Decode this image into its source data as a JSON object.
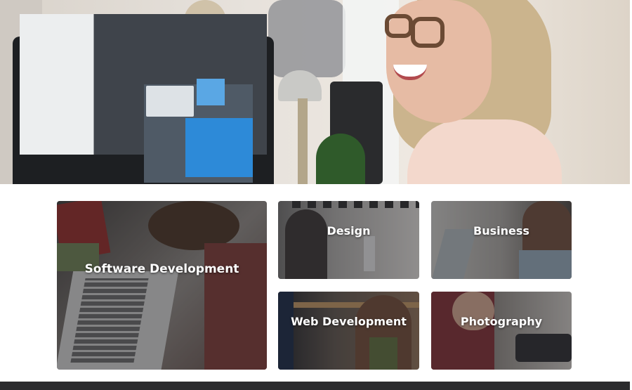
{
  "hero": {
    "image": "hero-photo-woman-smiling-at-computer"
  },
  "categories": [
    {
      "label": "Software Development"
    },
    {
      "label": "Design"
    },
    {
      "label": "Business"
    },
    {
      "label": "Web Development"
    },
    {
      "label": "Photography"
    }
  ],
  "colors": {
    "tile_text": "#ffffff",
    "footer_bar": "#2b2b2d",
    "page_background": "#ffffff"
  }
}
